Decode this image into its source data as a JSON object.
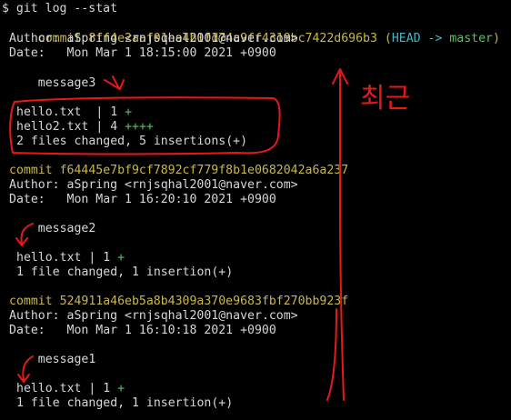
{
  "terminal": {
    "prompt_line": "$ git log --stat",
    "colors": {
      "background": "#000000",
      "text": "#d6d6d6",
      "commit": "#c8b84a",
      "ref": "#45b5c4",
      "insertions": "#55c655",
      "annotation": "#e81818"
    },
    "commits": [
      {
        "commit_line": "commit 8ff4e2aaf01ee4b1fd74c9ff4319bc7422d696b3",
        "ref_open": " (",
        "head": "HEAD -> ",
        "branch": "master",
        "ref_close": ")",
        "author": "Author: aSpring <rnjsqhal2001@naver.com>",
        "date": "Date:   Mon Mar 1 18:15:00 2021 +0900",
        "message": "    message3",
        "files": [
          {
            "name": "hello.txt  | 1 ",
            "plus": "+"
          },
          {
            "name": "hello2.txt | 4 ",
            "plus": "++++"
          }
        ],
        "summary": "2 files changed, 5 insertions(+)"
      },
      {
        "commit_line": "commit f64445e7bf9cf7892cf779f8b1e0682042a6a237",
        "author": "Author: aSpring <rnjsqhal2001@naver.com>",
        "date": "Date:   Mon Mar 1 16:20:10 2021 +0900",
        "message": "    message2",
        "files": [
          {
            "name": "hello.txt | 1 ",
            "plus": "+"
          }
        ],
        "summary": "1 file changed, 1 insertion(+)"
      },
      {
        "commit_line": "commit 524911a46eb5a8b4309a370e9683fbf270bb923f",
        "author": "Author: aSpring <rnjsqhal2001@naver.com>",
        "date": "Date:   Mon Mar 1 16:10:18 2021 +0900",
        "message": "    message1",
        "files": [
          {
            "name": "hello.txt | 1 ",
            "plus": "+"
          }
        ],
        "summary": "1 file changed, 1 insertion(+)"
      }
    ]
  },
  "annotation": {
    "label": "최근"
  }
}
